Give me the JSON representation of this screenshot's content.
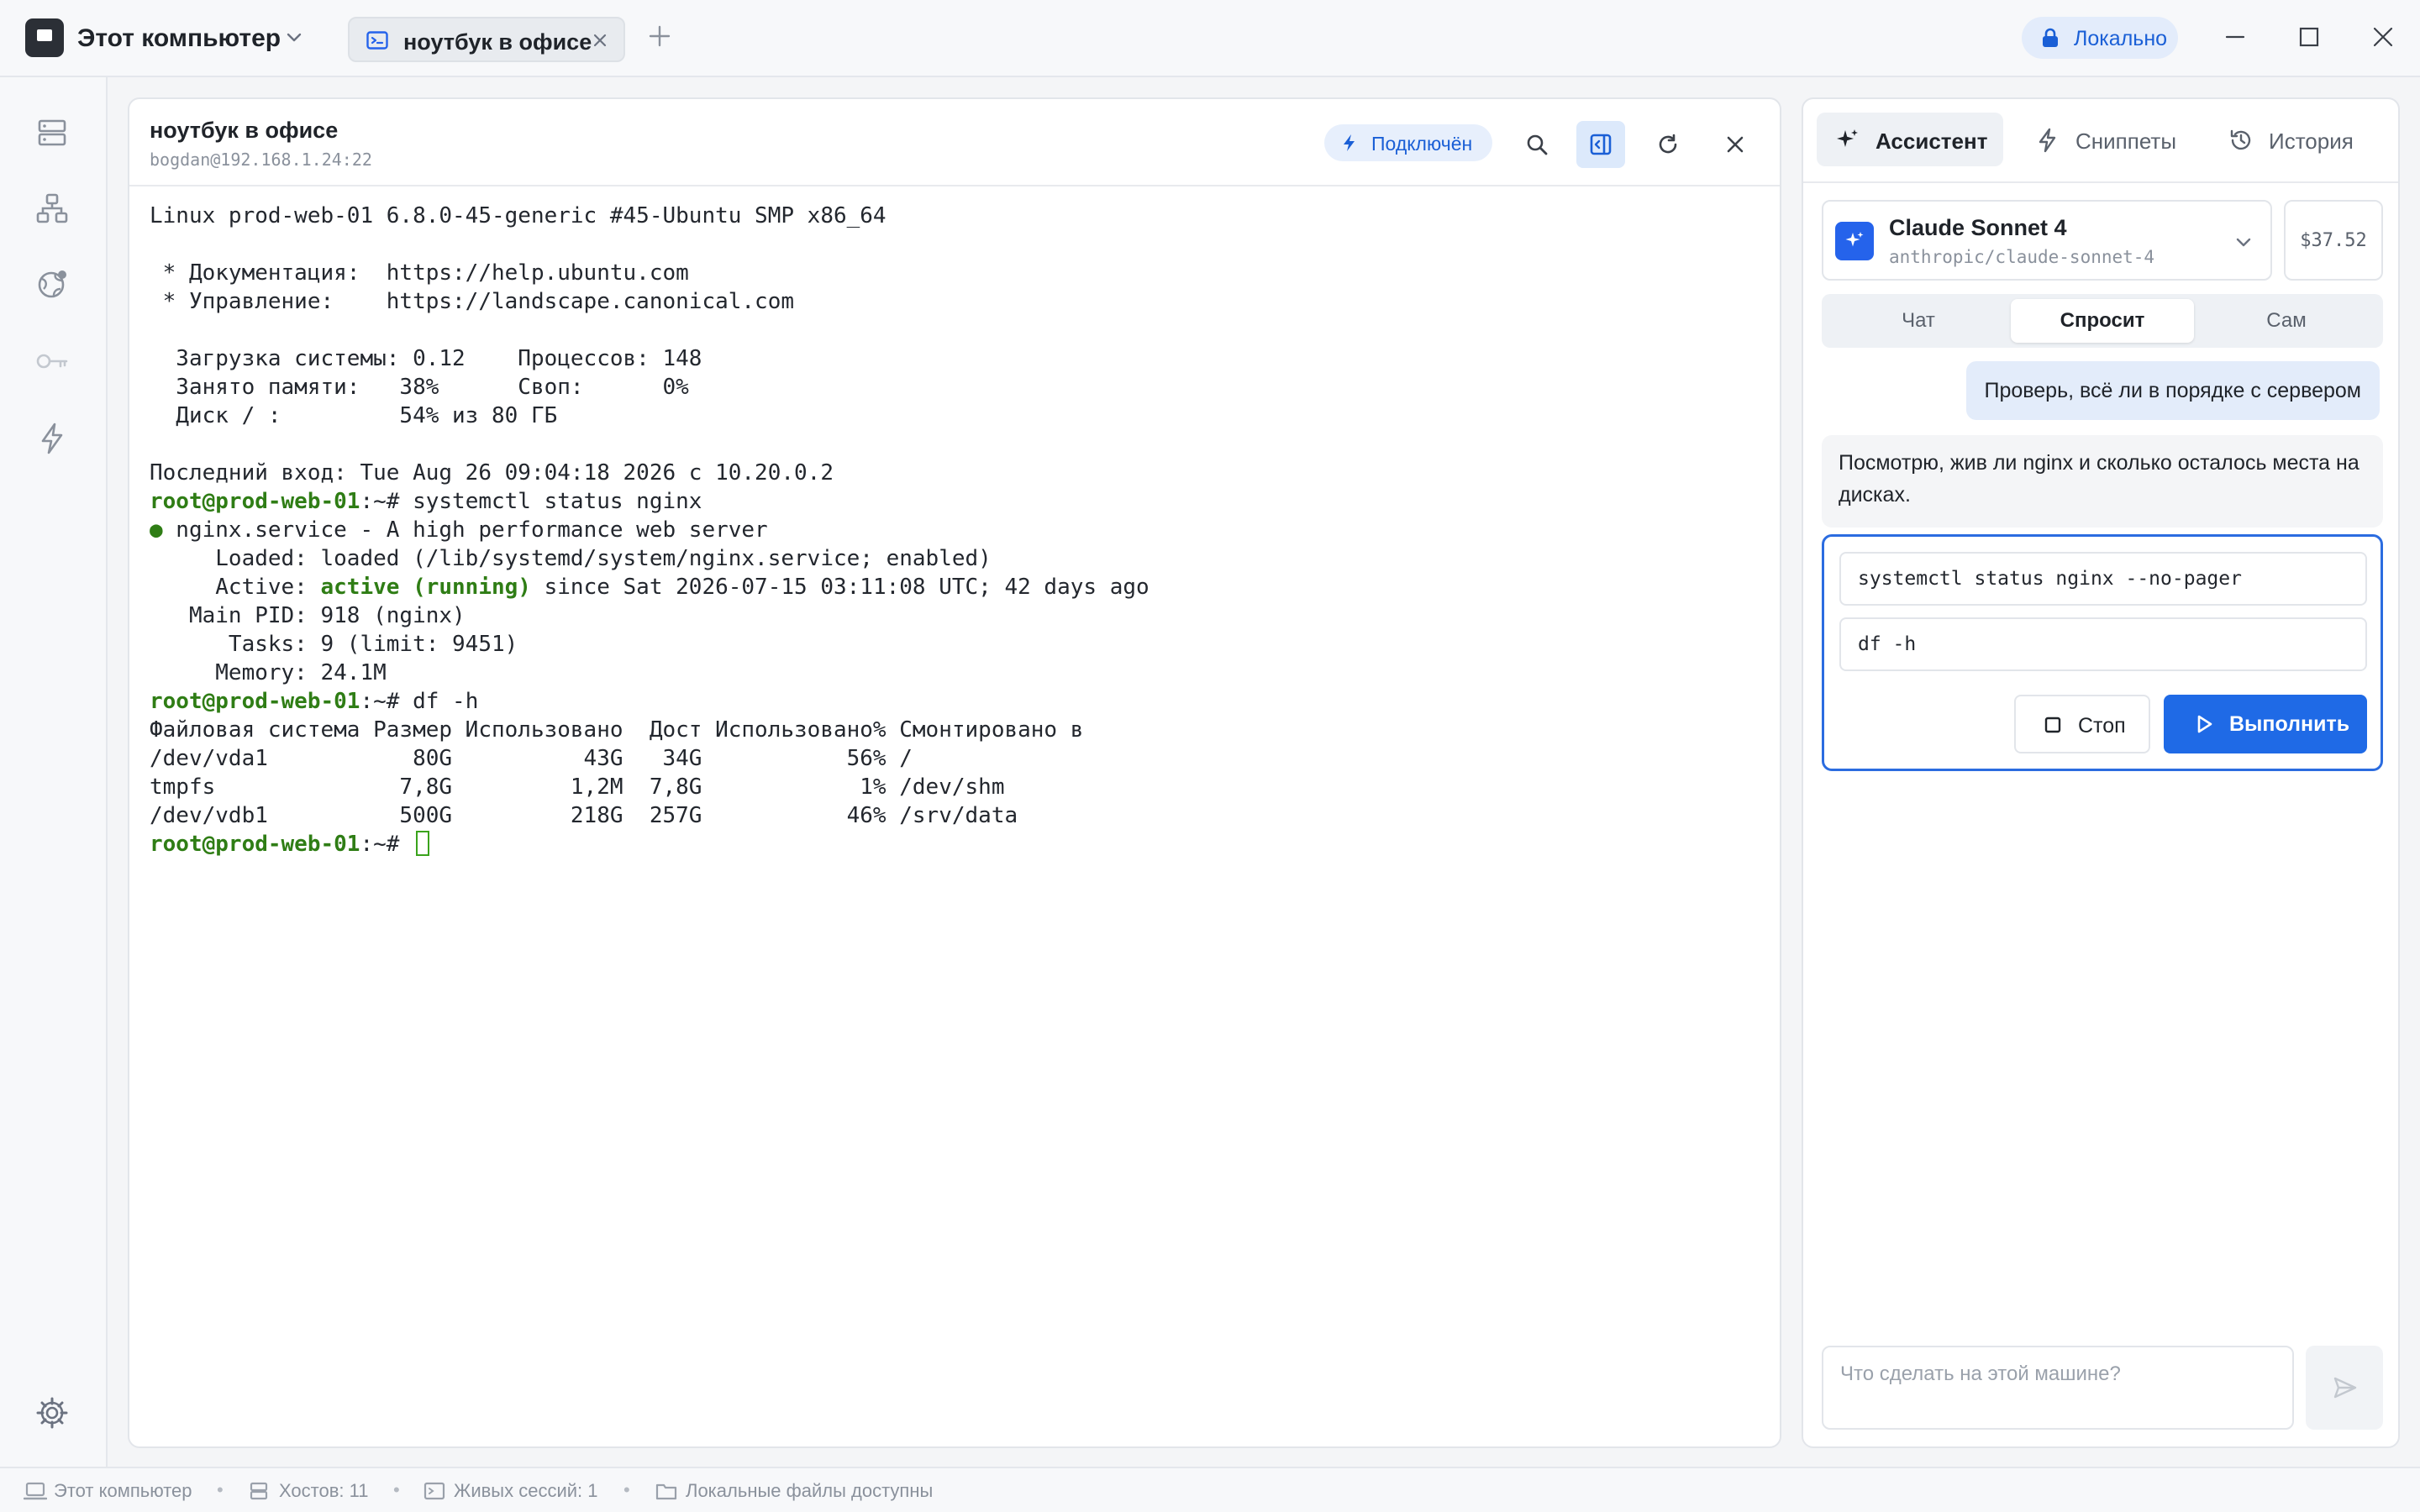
{
  "titlebar": {
    "app_title": "Этот компьютер",
    "tab_label": "ноутбук в офисе",
    "local_label": "Локально"
  },
  "terminal": {
    "title": "ноутбук в офисе",
    "subtitle": "bogdan@192.168.1.24:22",
    "status_label": "Подключён",
    "lines": [
      {
        "text": "Linux prod-web-01 6.8.0-45-generic #45-Ubuntu SMP x86_64"
      },
      {
        "text": ""
      },
      {
        "text": " * Документация:  https://help.ubuntu.com"
      },
      {
        "text": " * Управление:    https://landscape.canonical.com"
      },
      {
        "text": ""
      },
      {
        "text": "  Загрузка системы: 0.12    Процессов: 148"
      },
      {
        "text": "  Занято памяти:   38%      Своп:      0%"
      },
      {
        "text": "  Диск / :         54% из 80 ГБ"
      },
      {
        "text": ""
      },
      {
        "text": "Последний вход: Tue Aug 26 09:04:18 2026 с 10.20.0.2"
      },
      {
        "prompt": "root@prod-web-01",
        "path": ":~#",
        "text": " systemctl status nginx"
      },
      {
        "bullet": "●",
        "text": " nginx.service - A high performance web server"
      },
      {
        "text": "     Loaded: loaded (/lib/systemd/system/nginx.service; enabled)"
      },
      {
        "pre": "     Active: ",
        "ok": "active (running)",
        "text": " since Sat 2026-07-15 03:11:08 UTC; 42 days ago"
      },
      {
        "text": "   Main PID: 918 (nginx)"
      },
      {
        "text": "      Tasks: 9 (limit: 9451)"
      },
      {
        "text": "     Memory: 24.1M"
      },
      {
        "prompt": "root@prod-web-01",
        "path": ":~#",
        "text": " df -h"
      },
      {
        "text": "Файловая система Размер Использовано  Дост Использовано% Смонтировано в"
      },
      {
        "text": "/dev/vda1           80G          43G   34G           56% /"
      },
      {
        "text": "tmpfs              7,8G         1,2M  7,8G            1% /dev/shm"
      },
      {
        "text": "/dev/vdb1          500G         218G  257G           46% /srv/data"
      },
      {
        "prompt": "root@prod-web-01",
        "path": ":~#",
        "text": " ",
        "cursor": true
      }
    ]
  },
  "assistant": {
    "tabs": [
      {
        "label": "Ассистент",
        "active": true
      },
      {
        "label": "Сниппеты",
        "active": false
      },
      {
        "label": "История",
        "active": false
      }
    ],
    "model_name": "Claude Sonnet 4",
    "model_id": "anthropic/claude-sonnet-4",
    "cost": "$37.52",
    "modes": [
      {
        "label": "Чат",
        "active": false
      },
      {
        "label": "Спросит",
        "active": true
      },
      {
        "label": "Сам",
        "active": false
      }
    ],
    "user_message": "Проверь, всё ли в порядке с сервером",
    "assistant_message": "Посмотрю, жив ли nginx и сколько осталось места на дисках.",
    "commands": [
      "systemctl status nginx --no-pager",
      "df -h"
    ],
    "stop_label": "Стоп",
    "run_label": "Выполнить",
    "input_placeholder": "Что сделать на этой машине?"
  },
  "statusbar": {
    "computer": "Этот компьютер",
    "hosts": "Хостов: 11",
    "sessions": "Живых сессий: 1",
    "files": "Локальные файлы доступны"
  },
  "colors": {
    "accent": "#1f6ae6",
    "prompt_green": "#2f7d15",
    "terminal_text": "#23272e"
  }
}
